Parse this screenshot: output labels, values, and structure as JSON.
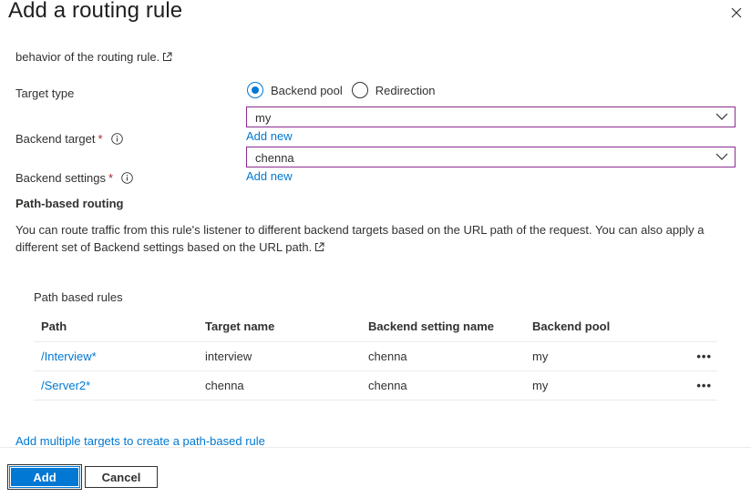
{
  "dialog": {
    "title": "Add a routing rule",
    "close_icon": "close-icon"
  },
  "intro": {
    "text": "behavior of the routing rule."
  },
  "form": {
    "target_type_label": "Target type",
    "target_type_options": [
      "Backend pool",
      "Redirection"
    ],
    "target_type_selected": "Backend pool",
    "backend_target_label": "Backend target",
    "backend_target_value": "my",
    "backend_settings_label": "Backend settings",
    "backend_settings_value": "chenna",
    "required_mark": "*",
    "add_new_label": "Add new"
  },
  "path_routing": {
    "heading": "Path-based routing",
    "description": "You can route traffic from this rule's listener to different backend targets based on the URL path of the request. You can also apply a different set of Backend settings based on the URL path.",
    "rules_label": "Path based rules",
    "columns": [
      "Path",
      "Target name",
      "Backend setting name",
      "Backend pool"
    ],
    "rows": [
      {
        "path": "/Interview*",
        "target": "interview",
        "setting": "chenna",
        "pool": "my"
      },
      {
        "path": "/Server2*",
        "target": "chenna",
        "setting": "chenna",
        "pool": "my"
      }
    ],
    "more_label": "•••",
    "add_multiple_link": "Add multiple targets to create a path-based rule"
  },
  "footer": {
    "add_label": "Add",
    "cancel_label": "Cancel"
  },
  "colors": {
    "accent": "#0078d4",
    "select_border": "#8a2d8f",
    "required": "#a4262c"
  }
}
